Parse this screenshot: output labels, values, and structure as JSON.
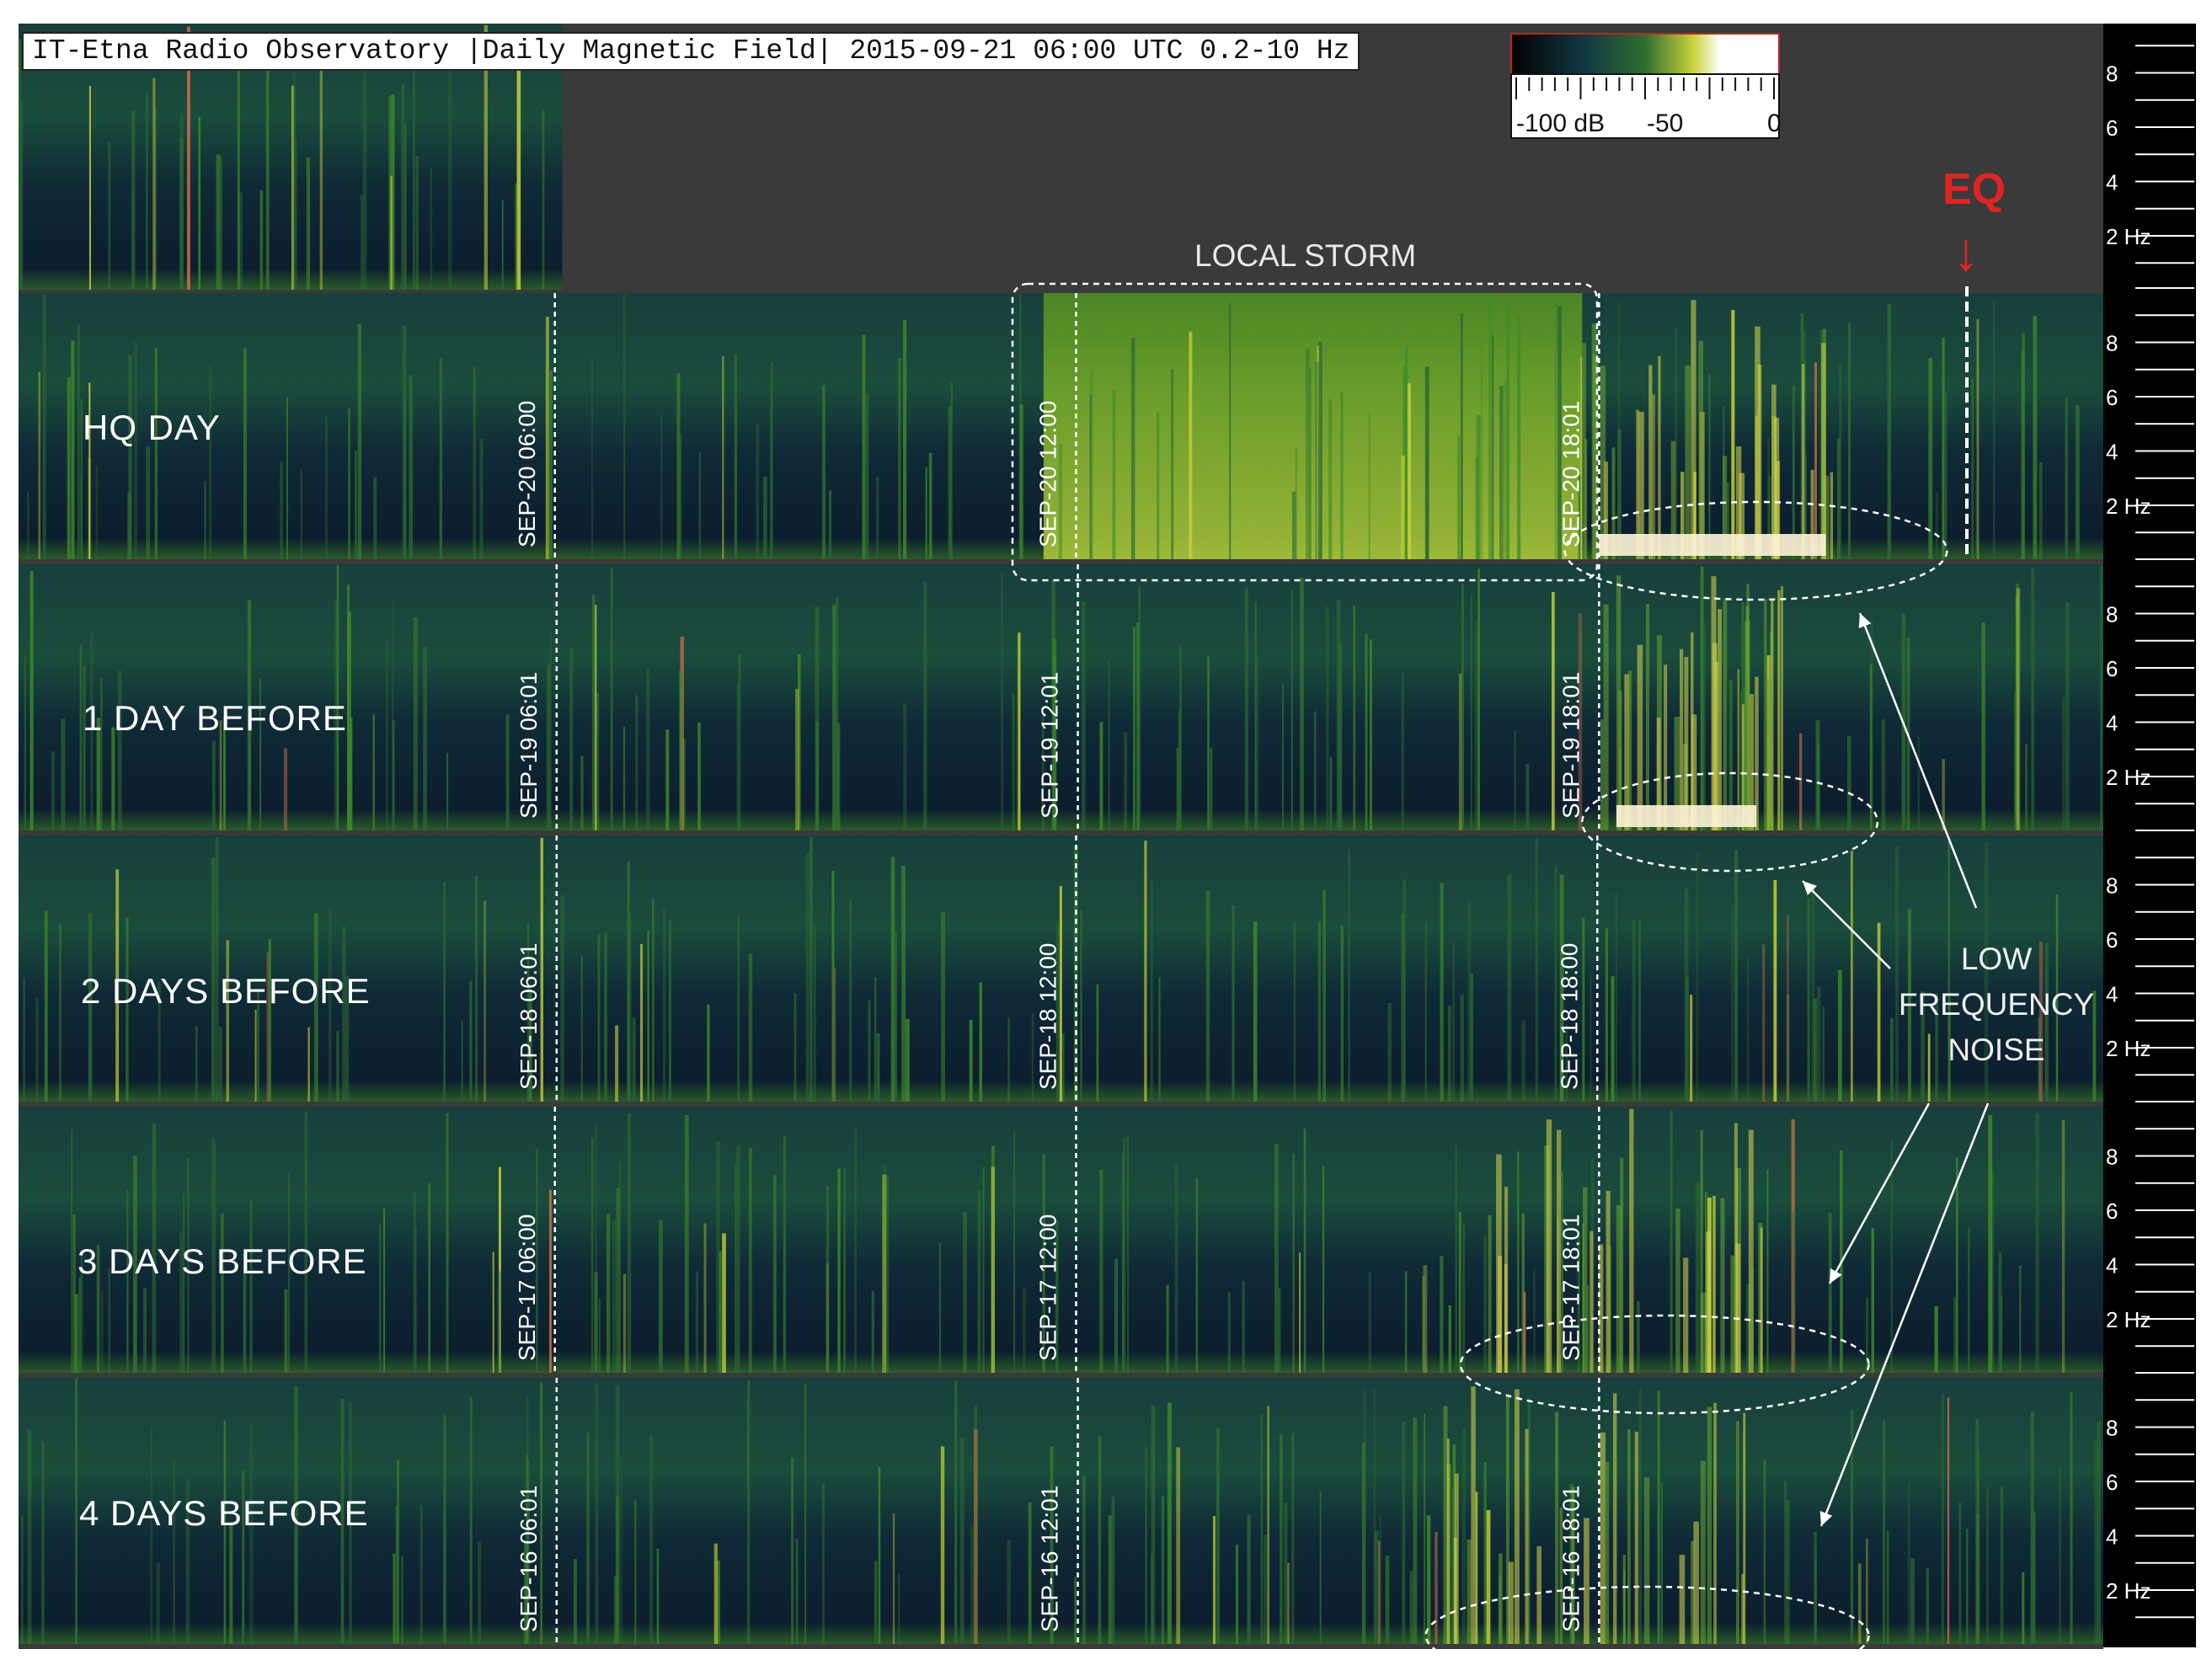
{
  "title": "IT-Etna Radio Observatory |Daily Magnetic Field| 2015-09-21 06:00 UTC 0.2-10 Hz",
  "colors": {
    "panel_dark": "#0e1c2a",
    "panel_mid": "#173a3a",
    "spectrum_green": "#4d8a22",
    "spectrum_yellow": "#e6e64a",
    "spectrum_red": "#c0483a",
    "frame": "#3a3a3a",
    "eq": "#e02424",
    "annotation": "#e8e8e8"
  },
  "colorbar": {
    "stops": [
      "#000000",
      "#123a44",
      "#2e6e2e",
      "#c8d23c",
      "#ffffff"
    ],
    "tick_labels": [
      "-100 dB",
      "-50",
      "0"
    ],
    "range_db": [
      -100,
      0
    ]
  },
  "annotations": {
    "local_storm": "LOCAL STORM",
    "eq": "EQ",
    "eq_arrow": "↓",
    "low_frequency_noise": [
      "LOW",
      "FREQUENCY",
      "NOISE"
    ]
  },
  "chart_data": {
    "type": "heatmap",
    "title": "IT-Etna Radio Observatory |Daily Magnetic Field| 2015-09-21 06:00 UTC 0.2-10 Hz",
    "frequency_range_hz": [
      0.2,
      10
    ],
    "frequency_ticks": [
      {
        "label": "8",
        "value": 8
      },
      {
        "label": "6",
        "value": 6
      },
      {
        "label": "4",
        "value": 4
      },
      {
        "label": "2 Hz",
        "value": 2
      }
    ],
    "rows_hours_span": 24,
    "eq_time": "2015-09-21 06:00",
    "rows": [
      {
        "label": "",
        "partial_hours": 5,
        "time_markers": []
      },
      {
        "label": "HQ DAY",
        "time_markers": [
          {
            "label": "SEP-20 06:00",
            "hour": 6
          },
          {
            "label": "SEP-20 12:00",
            "hour": 12
          },
          {
            "label": "SEP-20 18:01",
            "hour": 18.02
          }
        ],
        "eq_marker_hour": 24,
        "storm_hours": [
          11.8,
          18.0
        ],
        "ellipse_hours": [
          17.8,
          22.2
        ]
      },
      {
        "label": "1 DAY BEFORE",
        "time_markers": [
          {
            "label": "SEP-19 06:01",
            "hour": 6.02
          },
          {
            "label": "SEP-19 12:01",
            "hour": 12.02
          },
          {
            "label": "SEP-19 18:01",
            "hour": 18.02
          }
        ],
        "ellipse_hours": [
          18.0,
          21.4
        ]
      },
      {
        "label": "2 DAYS BEFORE",
        "time_markers": [
          {
            "label": "SEP-18 06:01",
            "hour": 6.02
          },
          {
            "label": "SEP-18 12:00",
            "hour": 12
          },
          {
            "label": "SEP-18 18:00",
            "hour": 18
          }
        ]
      },
      {
        "label": "3 DAYS BEFORE",
        "time_markers": [
          {
            "label": "SEP-17 06:00",
            "hour": 6
          },
          {
            "label": "SEP-17 12:00",
            "hour": 12
          },
          {
            "label": "SEP-17 18:01",
            "hour": 18.02
          }
        ],
        "ellipse_hours": [
          16.6,
          21.3
        ]
      },
      {
        "label": "4 DAYS BEFORE",
        "time_markers": [
          {
            "label": "SEP-16 06:01",
            "hour": 6.02
          },
          {
            "label": "SEP-16 12:01",
            "hour": 12.02
          },
          {
            "label": "SEP-16 18:01",
            "hour": 18.02
          }
        ],
        "ellipse_hours": [
          16.2,
          21.3
        ]
      }
    ]
  }
}
